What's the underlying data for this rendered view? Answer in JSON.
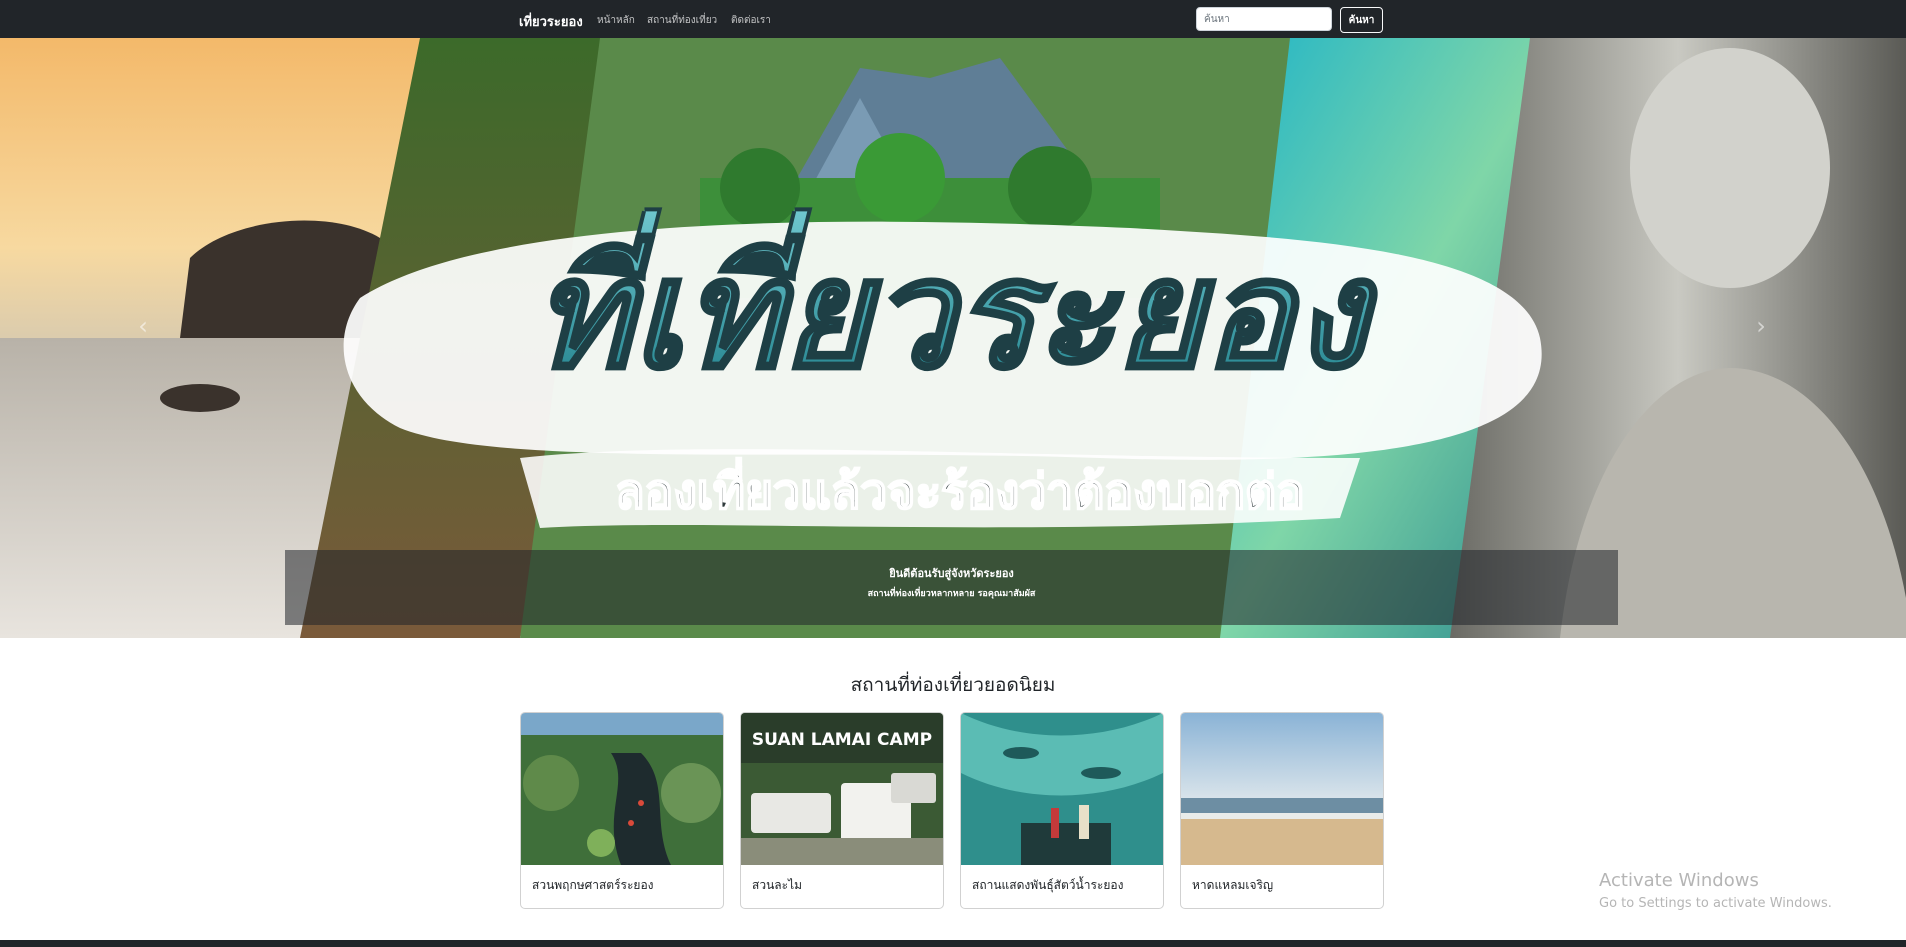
{
  "navbar": {
    "brand": "เที่ยวระยอง",
    "links": [
      "หน้าหลัก",
      "สถานที่ท่องเที่ยว",
      "ติดต่อเรา"
    ],
    "search": {
      "placeholder": "ค้นหา",
      "value": "",
      "button_label": "ค้นหา"
    }
  },
  "hero": {
    "banner_title": "ที่เที่ยวระยอง",
    "banner_tagline": "ลองเที่ยวแล้วจะร้องว่าต้องบอกต่อ",
    "caption_title": "ยินดีต้อนรับสู่จังหวัดระยอง",
    "caption_subtitle": "สถานที่ท่องเที่ยวหลากหลาย รอคุณมาสัมผัส",
    "prev_icon": "chevron-left-icon",
    "next_icon": "chevron-right-icon"
  },
  "popular": {
    "heading": "สถานที่ท่องเที่ยวยอดนิยม",
    "cards": [
      {
        "title": "สวนพฤกษศาสตร์ระยอง"
      },
      {
        "title": "สวนละไม",
        "image_text": "SUAN LAMAI CAMP"
      },
      {
        "title": "สถานแสดงพันธุ์สัตว์น้ำระยอง"
      },
      {
        "title": "หาดแหลมเจริญ"
      }
    ]
  },
  "watermark": {
    "title": "Activate Windows",
    "subtitle": "Go to Settings to activate Windows."
  },
  "colors": {
    "navbar_bg": "#212529",
    "banner_teal": "#2a9aa6",
    "caption_bg": "rgba(33,37,41,0.55)"
  }
}
